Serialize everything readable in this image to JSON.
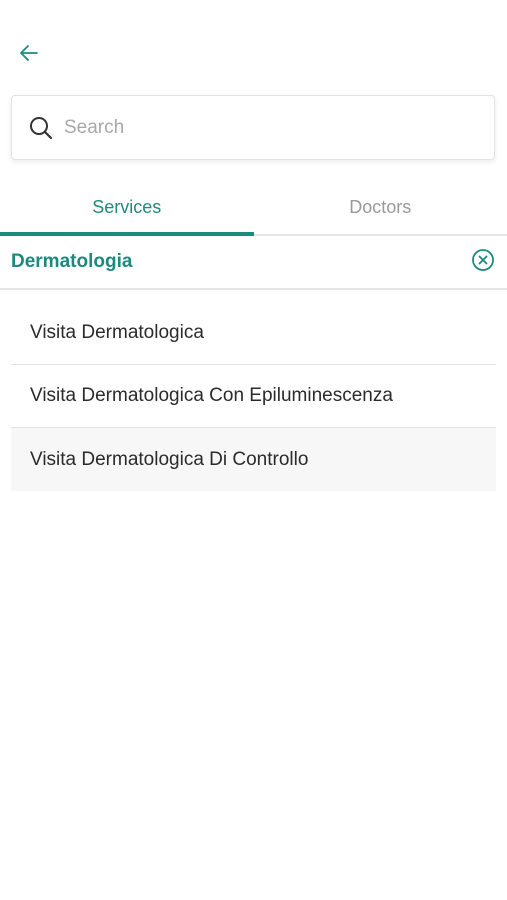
{
  "colors": {
    "accent": "#1d8a7e",
    "muted": "#9a9a9a",
    "placeholder": "#a8a8a8",
    "divider": "#e6e6e6"
  },
  "header": {
    "back_icon": "arrow-left-icon"
  },
  "search": {
    "icon": "search-icon",
    "placeholder": "Search",
    "value": ""
  },
  "tabs": [
    {
      "label": "Services",
      "active": true
    },
    {
      "label": "Doctors",
      "active": false
    }
  ],
  "filter": {
    "label": "Dermatologia",
    "clear_icon": "close-circle-icon"
  },
  "results": [
    {
      "label": "Visita Dermatologica"
    },
    {
      "label": "Visita Dermatologica Con Epiluminescenza"
    },
    {
      "label": "Visita Dermatologica Di Controllo"
    }
  ]
}
